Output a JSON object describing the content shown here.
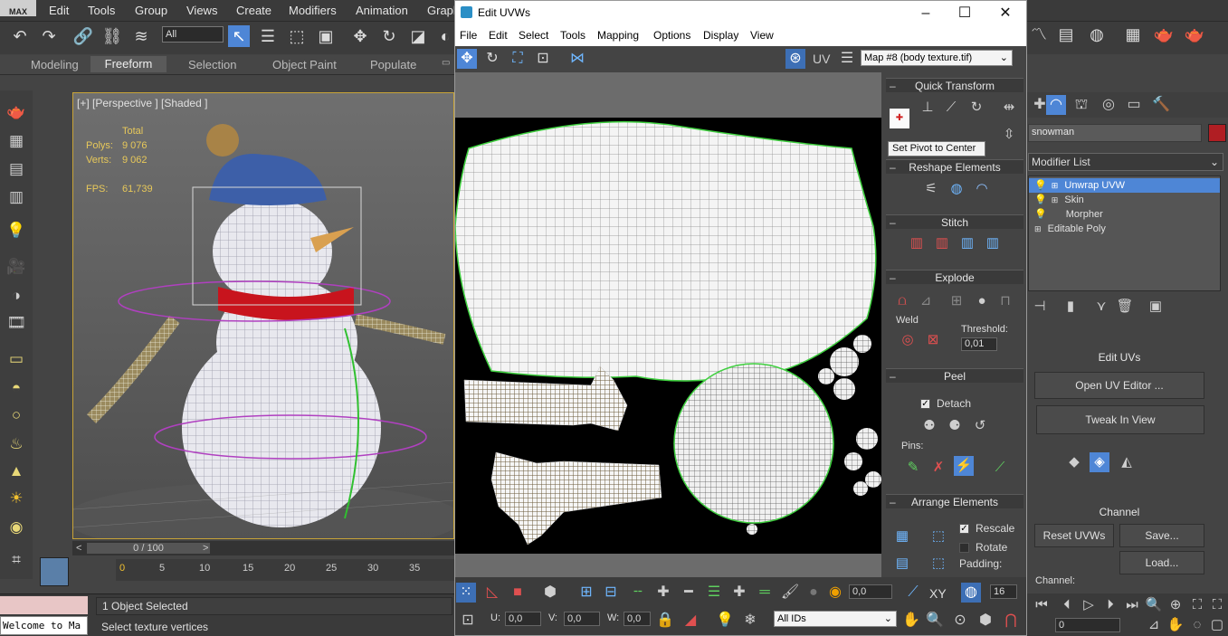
{
  "max": {
    "logo": "MAX",
    "menus": [
      "Edit",
      "Tools",
      "Group",
      "Views",
      "Create",
      "Modifiers",
      "Animation",
      "Graph"
    ],
    "selection_filter": "All",
    "ribbon_tabs": [
      "Modeling",
      "Freeform",
      "Selection",
      "Object Paint",
      "Populate"
    ],
    "viewport_label": "[+] [Perspective ] [Shaded ]",
    "stats": {
      "total_label": "Total",
      "polys_label": "Polys:",
      "polys_value": "9 076",
      "verts_label": "Verts:",
      "verts_value": "9 062",
      "fps_label": "FPS:",
      "fps_value": "61,739"
    },
    "time_slider": "0 / 100",
    "ruler_ticks": [
      "0",
      "5",
      "10",
      "15",
      "20",
      "25",
      "30",
      "35"
    ],
    "status": {
      "selected": "1 Object Selected",
      "prompt": "Select texture vertices",
      "listener": "Welcome to Ma"
    }
  },
  "uvw": {
    "title": "Edit UVWs",
    "menus": [
      "File",
      "Edit",
      "Select",
      "Tools",
      "Mapping",
      "Options",
      "Display",
      "View"
    ],
    "uv_label": "UV",
    "map": "Map #8 (body texture.tif)",
    "rollouts": {
      "quick_transform": "Quick Transform",
      "tooltip": "Set Pivot to Center",
      "reshape": "Reshape Elements",
      "stitch": "Stitch",
      "explode": "Explode",
      "weld": "Weld",
      "threshold_label": "Threshold:",
      "threshold_value": "0,01",
      "peel": "Peel",
      "detach": "Detach",
      "pins": "Pins:",
      "arrange": "Arrange Elements",
      "rescale": "Rescale",
      "rotate": "Rotate",
      "padding": "Padding:"
    },
    "bottom": {
      "value_field": "0,0",
      "xy": "XY",
      "zoom_value": "16",
      "u_label": "U:",
      "u_value": "0,0",
      "v_label": "V:",
      "v_value": "0,0",
      "w_label": "W:",
      "w_value": "0,0",
      "ids": "All IDs"
    }
  },
  "panel": {
    "object_name": "snowman",
    "object_color": "#b01e23",
    "modifier_list": "Modifier List",
    "stack": [
      "Unwrap UVW",
      "Skin",
      "Morpher",
      "Editable Poly"
    ],
    "edit_uvs": "Edit UVs",
    "open_editor": "Open UV Editor ...",
    "tweak": "Tweak In View",
    "channel": "Channel",
    "reset": "Reset UVWs",
    "save": "Save...",
    "load": "Load...",
    "channel_label": "Channel:",
    "frame_value": "0"
  }
}
